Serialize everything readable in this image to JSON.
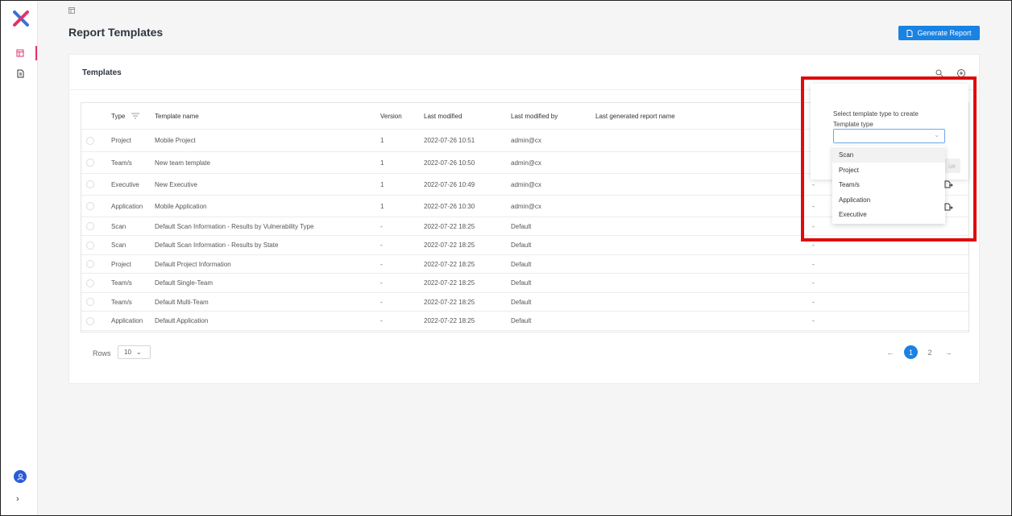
{
  "page": {
    "title": "Report Templates",
    "generate_button": "Generate Report"
  },
  "sidebar": {
    "icons": [
      "logo-x-icon",
      "templates-icon",
      "report-file-icon",
      "user-avatar-icon",
      "chevron-right-icon"
    ]
  },
  "card": {
    "title": "Templates",
    "icons": [
      "search-icon",
      "add-circle-icon"
    ]
  },
  "table": {
    "columns": [
      "Type",
      "Template name",
      "Version",
      "Last modified",
      "Last modified by",
      "Last generated report name"
    ],
    "rows": [
      {
        "type": "Project",
        "name": "Mobile Project",
        "version": "1",
        "modified": "2022-07-26 10:51",
        "by": "admin@cx",
        "report": ""
      },
      {
        "type": "Team/s",
        "name": "New team template",
        "version": "1",
        "modified": "2022-07-26 10:50",
        "by": "admin@cx",
        "report": ""
      },
      {
        "type": "Executive",
        "name": "New Executive",
        "version": "1",
        "modified": "2022-07-26 10:49",
        "by": "admin@cx",
        "report": "-"
      },
      {
        "type": "Application",
        "name": "Mobile Application",
        "version": "1",
        "modified": "2022-07-26 10:30",
        "by": "admin@cx",
        "report": "-"
      },
      {
        "type": "Scan",
        "name": "Default Scan Information - Results by Vulnerability Type",
        "version": "-",
        "modified": "2022-07-22 18:25",
        "by": "Default",
        "report": "-"
      },
      {
        "type": "Scan",
        "name": "Default Scan Information - Results by State",
        "version": "-",
        "modified": "2022-07-22 18:25",
        "by": "Default",
        "report": "-"
      },
      {
        "type": "Project",
        "name": "Default Project Information",
        "version": "-",
        "modified": "2022-07-22 18:25",
        "by": "Default",
        "report": "-"
      },
      {
        "type": "Team/s",
        "name": "Default Single-Team",
        "version": "-",
        "modified": "2022-07-22 18:25",
        "by": "Default",
        "report": "-"
      },
      {
        "type": "Team/s",
        "name": "Default Multi-Team",
        "version": "-",
        "modified": "2022-07-22 18:25",
        "by": "Default",
        "report": "-"
      },
      {
        "type": "Application",
        "name": "Default Application",
        "version": "-",
        "modified": "2022-07-22 18:25",
        "by": "Default",
        "report": "-"
      }
    ]
  },
  "pagination": {
    "rows_label": "Rows",
    "rows_value": "10",
    "pages": [
      "1",
      "2"
    ],
    "current_page": "1"
  },
  "popup": {
    "prompt": "Select template type to create",
    "label": "Template type",
    "select_value": "",
    "continue_label": "ue",
    "options": [
      "Scan",
      "Project",
      "Team/s",
      "Application",
      "Executive"
    ],
    "highlighted_option": "Scan"
  },
  "colors": {
    "accent": "#1a82e2",
    "highlight_box": "#e00b0b",
    "nav_active": "#e0336a"
  }
}
